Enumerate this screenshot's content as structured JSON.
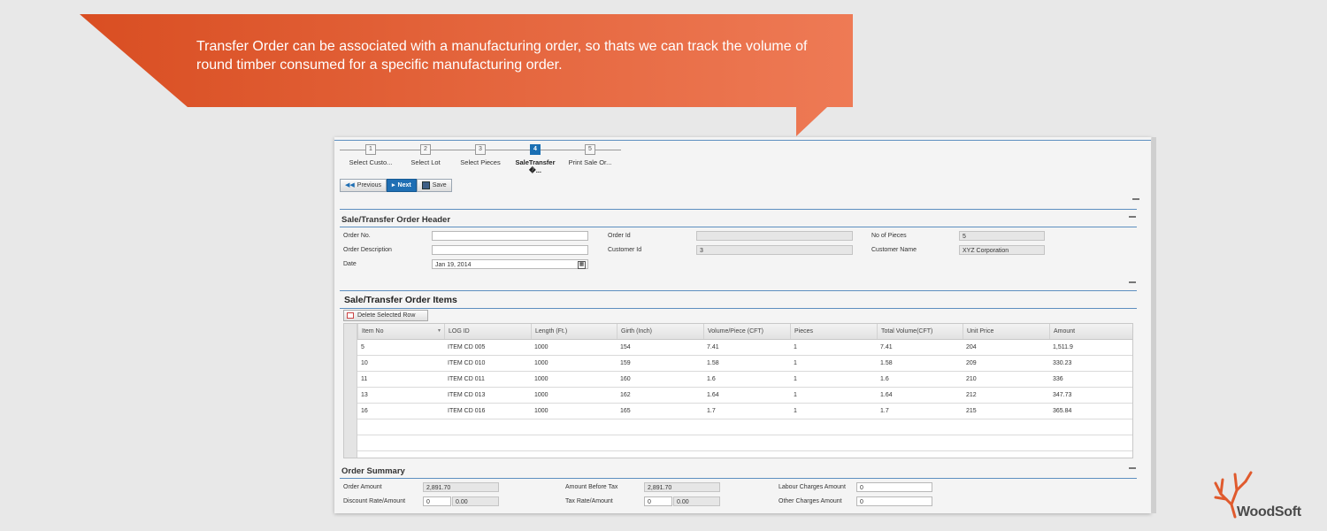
{
  "banner": {
    "text": "Transfer Order can be associated with a manufacturing order, so thats we can track the volume of round timber consumed for a specific manufacturing order.",
    "color": "#e05a2d"
  },
  "wizard": {
    "steps": [
      {
        "num": "1",
        "label": "Select Custo..."
      },
      {
        "num": "2",
        "label": "Select Lot"
      },
      {
        "num": "3",
        "label": "Select Pieces"
      },
      {
        "num": "4",
        "label": "SaleTransfer �...",
        "active": true
      },
      {
        "num": "5",
        "label": "Print Sale Or..."
      }
    ]
  },
  "nav": {
    "previous": "Previous",
    "next": "Next",
    "save": "Save"
  },
  "header_section": {
    "title": "Sale/Transfer Order Header",
    "order_no_label": "Order No.",
    "order_no_value": "",
    "order_desc_label": "Order Description",
    "order_desc_value": "",
    "date_label": "Date",
    "date_value": "Jan 19, 2014",
    "order_id_label": "Order Id",
    "order_id_value": "",
    "customer_id_label": "Customer Id",
    "customer_id_value": "3",
    "pieces_label": "No of Pieces",
    "pieces_value": "5",
    "customer_name_label": "Customer Name",
    "customer_name_value": "XYZ Corporation"
  },
  "items_section": {
    "title": "Sale/Transfer Order Items",
    "delete_button": "Delete Selected Row",
    "columns": [
      "Item No",
      "LOG ID",
      "Length (Ft.)",
      "Girth (Inch)",
      "Volume/Piece (CFT)",
      "Pieces",
      "Total Volume(CFT)",
      "Unit Price",
      "Amount"
    ],
    "rows": [
      [
        "5",
        "ITEM CD 005",
        "1000",
        "154",
        "7.41",
        "1",
        "7.41",
        "204",
        "1,511.9"
      ],
      [
        "10",
        "ITEM CD 010",
        "1000",
        "159",
        "1.58",
        "1",
        "1.58",
        "209",
        "330.23"
      ],
      [
        "11",
        "ITEM CD 011",
        "1000",
        "160",
        "1.6",
        "1",
        "1.6",
        "210",
        "336"
      ],
      [
        "13",
        "ITEM CD 013",
        "1000",
        "162",
        "1.64",
        "1",
        "1.64",
        "212",
        "347.73"
      ],
      [
        "16",
        "ITEM CD 016",
        "1000",
        "165",
        "1.7",
        "1",
        "1.7",
        "215",
        "365.84"
      ]
    ]
  },
  "summary_section": {
    "title": "Order Summary",
    "order_amount_label": "Order Amount",
    "order_amount_value": "2,891.70",
    "discount_label": "Discount Rate/Amount",
    "discount_rate": "0",
    "discount_amount": "0.00",
    "amount_before_tax_label": "Amount Before Tax",
    "amount_before_tax_value": "2,891.70",
    "tax_label": "Tax Rate/Amount",
    "tax_rate": "0",
    "tax_amount": "0.00",
    "labour_label": "Labour Charges Amount",
    "labour_value": "0",
    "other_label": "Other Charges Amount",
    "other_value": "0"
  },
  "logo": {
    "text": "WoodSoft",
    "icon": "tree-antler-icon",
    "color": "#e05a2d"
  }
}
